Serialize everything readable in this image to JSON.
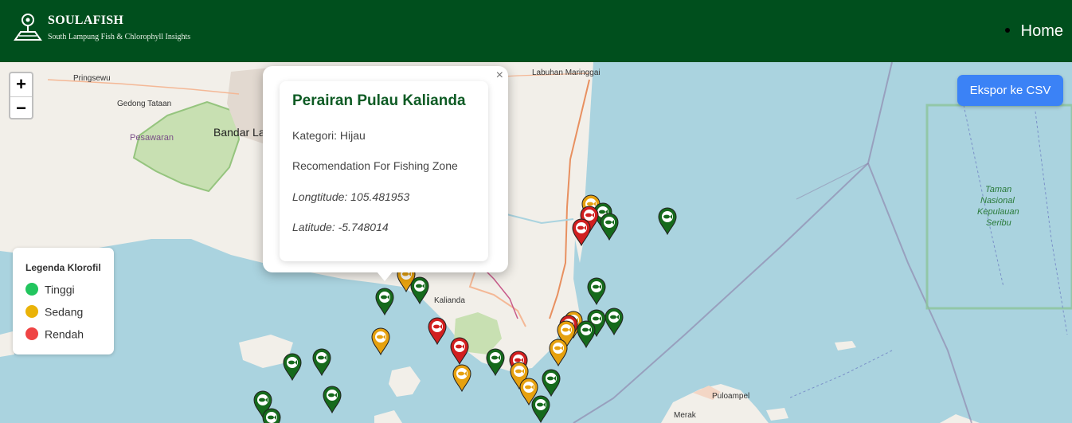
{
  "header": {
    "brand": "SOULAFISH",
    "tagline": "South Lampung Fish & Chlorophyll Insights",
    "nav": [
      {
        "label": "Home"
      }
    ]
  },
  "controls": {
    "zoom_in": "+",
    "zoom_out": "−",
    "export_label": "Ekspor ke CSV"
  },
  "legend": {
    "title": "Legenda Klorofil",
    "items": [
      {
        "label": "Tinggi",
        "color": "#22c55e"
      },
      {
        "label": "Sedang",
        "color": "#eab308"
      },
      {
        "label": "Rendah",
        "color": "#ef4444"
      }
    ]
  },
  "popup": {
    "close": "×",
    "title": "Perairan Pulau Kalianda",
    "category": "Kategori: Hijau",
    "recommendation": "Recomendation For Fishing Zone",
    "longitude": "Longtitude: 105.481953",
    "latitude": "Latitude: -5.748014"
  },
  "map_labels": {
    "labuhan": "Labuhan Maringgai",
    "pringsewu": "Pringsewu",
    "gedong": "Gedong Tataan",
    "bandar": "Bandar La",
    "pesawaran": "Pesawaran",
    "kalianda": "Kalianda",
    "taman": "Taman",
    "nasional": "Nasional",
    "kepulauan": "Kepulauan",
    "seribu": "Seribu",
    "puloampel": "Puloampel",
    "merak": "Merak"
  },
  "marker_colors": {
    "green": "#166a1c",
    "orange": "#e6a10f",
    "red": "#d11f1f"
  }
}
